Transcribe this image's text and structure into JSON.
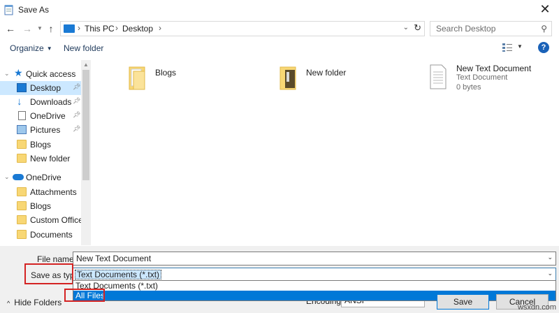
{
  "window": {
    "title": "Save As",
    "close_glyph": "✕"
  },
  "nav": {
    "back_glyph": "←",
    "forward_glyph": "→",
    "up_glyph": "↑",
    "breadcrumbs": [
      "This PC",
      "Desktop"
    ],
    "search_placeholder": "Search Desktop"
  },
  "toolbar": {
    "organize_label": "Organize",
    "new_folder_label": "New folder"
  },
  "sidebar": {
    "items": [
      {
        "label": "Quick access",
        "icon": "star-icon"
      },
      {
        "label": "Desktop",
        "icon": "desktop-icon",
        "pinned": true,
        "selected": true
      },
      {
        "label": "Downloads",
        "icon": "download-icon",
        "pinned": true
      },
      {
        "label": "OneDrive",
        "icon": "file-icon",
        "pinned": true
      },
      {
        "label": "Pictures",
        "icon": "pictures-icon",
        "pinned": true
      },
      {
        "label": "Blogs",
        "icon": "folder-icon"
      },
      {
        "label": "New folder",
        "icon": "folder-icon"
      },
      {
        "label": "OneDrive",
        "icon": "cloud-icon"
      },
      {
        "label": "Attachments",
        "icon": "folder-icon"
      },
      {
        "label": "Blogs",
        "icon": "folder-icon"
      },
      {
        "label": "Custom Office T",
        "icon": "folder-icon"
      },
      {
        "label": "Documents",
        "icon": "folder-icon"
      }
    ]
  },
  "files": [
    {
      "name": "Blogs",
      "kind": "folder"
    },
    {
      "name": "New folder",
      "kind": "folder"
    },
    {
      "name": "New Text Document",
      "type": "Text Document",
      "size": "0 bytes",
      "kind": "text"
    }
  ],
  "form": {
    "file_name_label": "File name:",
    "file_name_value": "New Text Document",
    "save_type_label": "Save as type:",
    "save_type_value": "Text Documents (*.txt)",
    "type_options": [
      "Text Documents (*.txt)",
      "All Files"
    ],
    "selected_option": "All Files",
    "encoding_label": "Encoding:",
    "encoding_value": "ANSI"
  },
  "footer": {
    "hide_folders_label": "Hide Folders",
    "save_label": "Save",
    "cancel_label": "Cancel",
    "watermark": "wsxdn.com"
  },
  "colors": {
    "accent": "#0078d7",
    "highlight_box": "#d42323",
    "selection": "#cce8ff"
  }
}
